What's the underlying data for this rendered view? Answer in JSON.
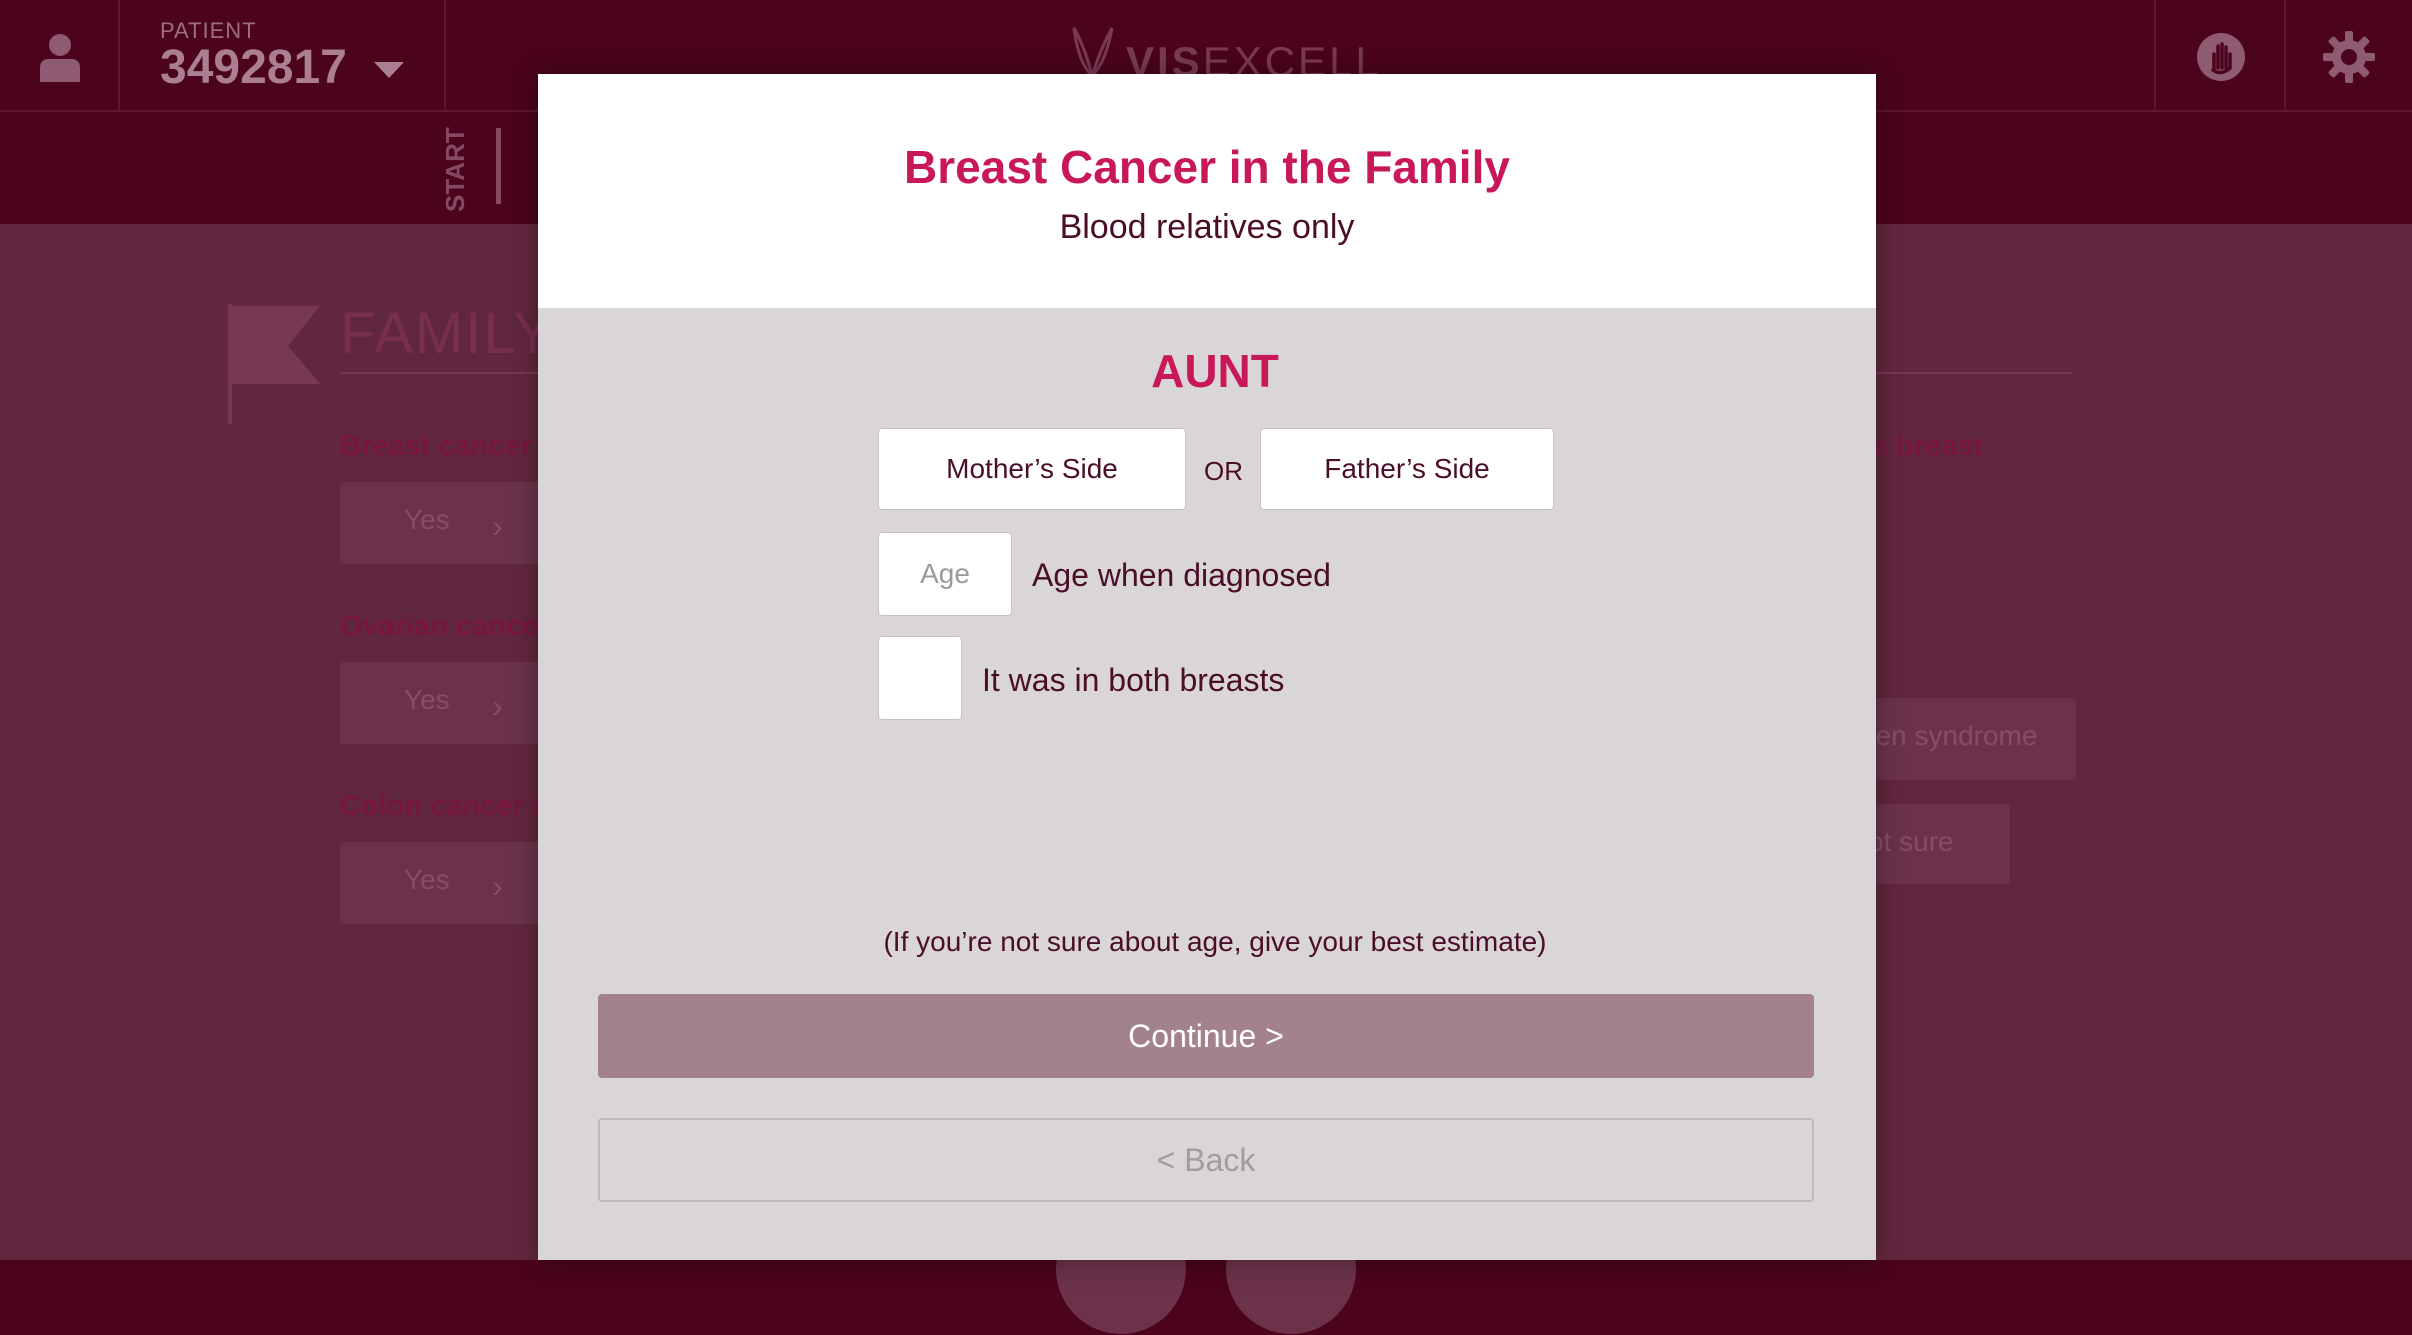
{
  "topbar": {
    "patient_label": "PATIENT",
    "patient_number": "3492817",
    "logo_bold": "VIS",
    "logo_light": "EXCELL",
    "icons": [
      "user-icon",
      "help-hand-icon",
      "gear-icon",
      "chevron-down-icon"
    ]
  },
  "navbar": {
    "start_label": "START"
  },
  "background": {
    "section_title": "FAMILY",
    "questions": [
      {
        "label": "Breast cancer",
        "answer": "Yes"
      },
      {
        "label": "Ovarian cance",
        "answer": "Yes"
      },
      {
        "label": "Colon cancer i",
        "answer": "Yes"
      }
    ],
    "right_question": "a breast",
    "right_options": [
      "den syndrome",
      "ot sure"
    ]
  },
  "modal": {
    "title": "Breast Cancer in the Family",
    "subtitle": "Blood relatives only",
    "relative": "AUNT",
    "mothers_side": "Mother’s Side",
    "or_label": "OR",
    "fathers_side": "Father’s Side",
    "age_placeholder": "Age",
    "age_value": "",
    "age_label": "Age when diagnosed",
    "both_breasts_label": "It was in both breasts",
    "hint": "(If you’re not sure about age, give your best estimate)",
    "continue_label": "Continue >",
    "back_label": "< Back"
  },
  "colors": {
    "accent": "#c8185a",
    "header": "#54051f",
    "continue": "#a4818e",
    "modal_body": "#dad5d6"
  }
}
